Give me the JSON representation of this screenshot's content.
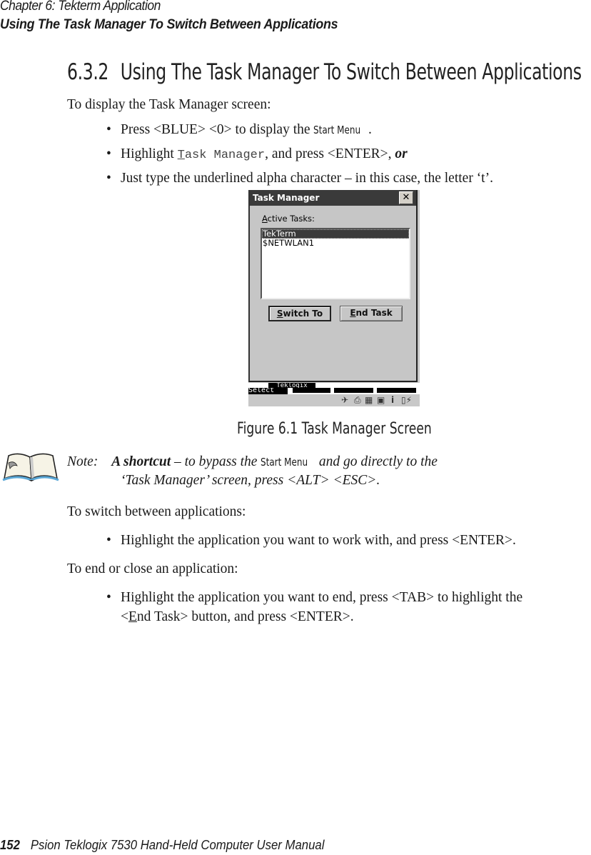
{
  "header": {
    "chapter": "Chapter   6:   Tekterm Application",
    "section": "Using The Task Manager To Switch Between Applications"
  },
  "section_heading": {
    "number": "6.3.2",
    "title": "Using The Task Manager To Switch Between Applications"
  },
  "intro": {
    "lead": "To display the Task Manager screen:",
    "bullets": [
      {
        "pre": "Press <BLUE> <0> to display the ",
        "ui": "Start Menu",
        "post": "."
      },
      {
        "pre": "Highlight ",
        "mono_first": "T",
        "mono_rest": "ask Manager",
        "post": ",  and press <ENTER>, ",
        "emph": "or"
      },
      {
        "text": "Just type the underlined alpha character – in this case, the letter ‘t’."
      }
    ]
  },
  "figure": {
    "window_title": "Task Manager",
    "close_glyph": "✕",
    "label_first": "A",
    "label_rest": "ctive Tasks:",
    "tasks": [
      {
        "name": "TekTerm",
        "selected": true
      },
      {
        "name": "$NETWLAN1",
        "selected": false
      }
    ],
    "buttons": [
      {
        "first": "S",
        "rest": "witch To"
      },
      {
        "first": "E",
        "rest": "nd Task"
      }
    ],
    "softkey_brand": "Teklogix",
    "softkey_left": "Select",
    "status_icons": [
      "network-icon",
      "printer-icon",
      "signal-icon",
      "connection-icon",
      "info-icon",
      "battery-icon"
    ],
    "caption": "Figure 6.1  Task Manager Screen"
  },
  "note": {
    "label": "Note:",
    "bold": "A shortcut",
    "text1": " – to bypass the ",
    "ui": "Start Menu",
    "text2": " and go directly to the",
    "line2": "‘Task Manager’ screen, press <ALT> <ESC>."
  },
  "switch": {
    "lead": "To switch between applications:",
    "bullet": "Highlight the application you want to work with, and press <ENTER>."
  },
  "end": {
    "lead": "To end or close an application:",
    "bullet_line1": "Highlight the application you want to end, press <TAB> to highlight the",
    "bullet_line2_pre": "<",
    "bullet_line2_u": "E",
    "bullet_line2_post": "nd Task> button, and press <ENTER>."
  },
  "footer": {
    "page": "152",
    "title": "Psion Teklogix 7530 Hand-Held Computer User Manual"
  }
}
